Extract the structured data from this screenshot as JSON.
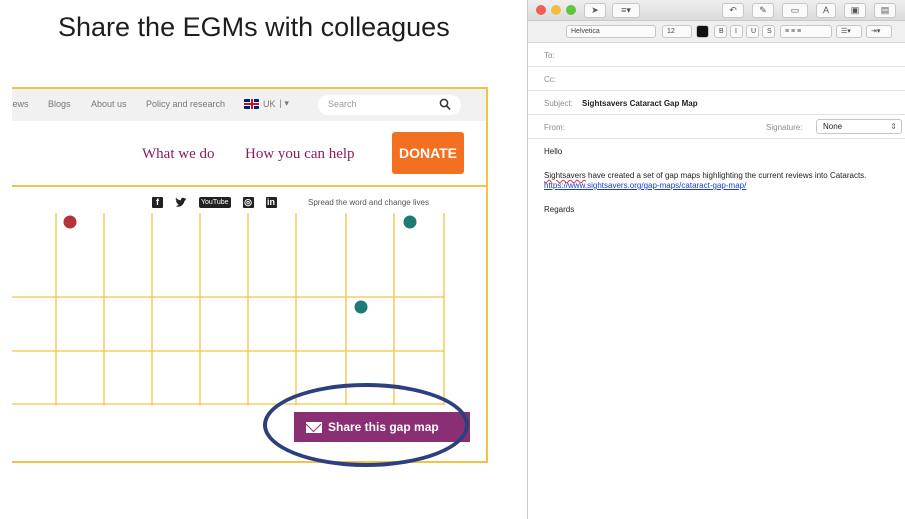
{
  "slide": {
    "title": "Share the EGMs with colleagues"
  },
  "website": {
    "top_nav": {
      "news": "News",
      "blogs": "Blogs",
      "about": "About us",
      "policy": "Policy and research",
      "region": "UK",
      "region_caret": "| ▾"
    },
    "search": {
      "placeholder": "Search",
      "icon": "search-icon"
    },
    "main_nav": {
      "what_we_do": "What we do",
      "how_you_can_help": "How you can help",
      "donate": "DONATE"
    },
    "social": {
      "facebook": "f",
      "youtube": "YouTube",
      "instagram": "◎",
      "linkedin": "in",
      "tagline": "Spread the word and change lives"
    },
    "share_button": "Share this gap map",
    "colors": {
      "accent_purple": "#8b2f74",
      "donate_orange": "#f37021",
      "grid_yellow": "#f3c343",
      "dot_red": "#b3343a",
      "dot_teal": "#1f7a72",
      "ring_blue": "#2c3f7f"
    }
  },
  "mail": {
    "format_bar": {
      "font": "Helvetica",
      "size": "12",
      "bold": "B",
      "italic": "I",
      "underline": "U",
      "strike": "S"
    },
    "toolbar": {
      "text_button": "A"
    },
    "to_label": "To:",
    "cc_label": "Cc:",
    "subject_label": "Subject:",
    "subject": "Sightsavers Cataract Gap Map",
    "from_label": "From:",
    "signature_label": "Signature:",
    "signature_value": "None",
    "body": {
      "greeting": "Hello",
      "line_word": "Sightsavers",
      "line_rest": " have created a set of gap maps highlighting the current reviews into Cataracts.",
      "link": "https://www.sightsavers.org/gap-maps/cataract-gap-map/",
      "closing": "Regards"
    }
  }
}
